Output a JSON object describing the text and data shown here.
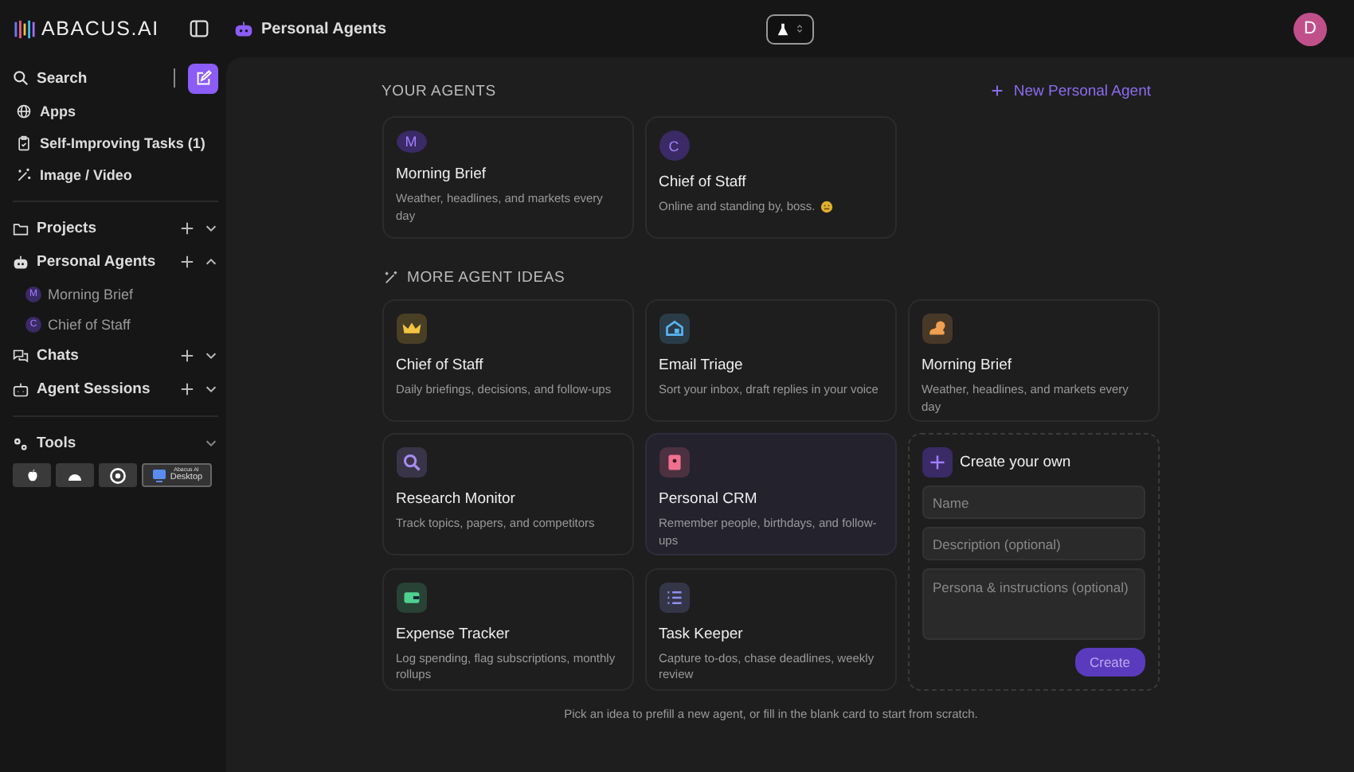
{
  "brand": "ABACUS.AI",
  "header": {
    "title": "Personal Agents",
    "avatar": "D"
  },
  "sidebar": {
    "search": "Search",
    "nav": [
      {
        "label": "Apps"
      },
      {
        "label": "Self-Improving Tasks (1)"
      },
      {
        "label": "Image / Video"
      }
    ],
    "sections": [
      {
        "label": "Projects",
        "expanded": false
      },
      {
        "label": "Personal Agents",
        "expanded": true,
        "children": [
          {
            "label": "Morning Brief",
            "initial": "M"
          },
          {
            "label": "Chief of Staff",
            "initial": "C"
          }
        ]
      },
      {
        "label": "Chats",
        "expanded": false
      },
      {
        "label": "Agent Sessions",
        "expanded": false
      }
    ],
    "tools": {
      "label": "Tools",
      "desktop": [
        "Abacus AI",
        "Desktop"
      ]
    }
  },
  "your_agents": {
    "title": "YOUR AGENTS",
    "new_button": "New Personal Agent",
    "agents": [
      {
        "initial": "M",
        "name": "Morning Brief",
        "description": "Weather, headlines, and markets every day",
        "emoji": false
      },
      {
        "initial": "C",
        "name": "Chief of Staff",
        "description": "Online and standing by, boss.",
        "emoji": true
      }
    ]
  },
  "ideas": {
    "title": "MORE AGENT IDEAS",
    "items": [
      {
        "name": "Chief of Staff",
        "description": "Daily briefings, decisions, and follow-ups",
        "color": "#f5c542",
        "selected": false
      },
      {
        "name": "Email Triage",
        "description": "Sort your inbox, draft replies in your voice",
        "color": "#5ab4f0",
        "selected": false
      },
      {
        "name": "Morning Brief",
        "description": "Weather, headlines, and markets every day",
        "color": "#f0a050",
        "selected": false
      },
      {
        "name": "Research Monitor",
        "description": "Track topics, papers, and competitors",
        "color": "#a68cf0",
        "selected": false
      },
      {
        "name": "Personal CRM",
        "description": "Remember people, birthdays, and follow-ups",
        "color": "#f07090",
        "selected": true
      },
      {
        "name": "Expense Tracker",
        "description": "Log spending, flag subscriptions, monthly rollups",
        "color": "#4fd08f",
        "selected": false
      },
      {
        "name": "Task Keeper",
        "description": "Capture to-dos, chase deadlines, weekly review",
        "color": "#8f90f0",
        "selected": false
      }
    ],
    "create": {
      "title": "Create your own",
      "name_placeholder": "Name",
      "description_placeholder": "Description (optional)",
      "persona_placeholder": "Persona & instructions (optional)",
      "button": "Create"
    }
  },
  "footer": "Pick an idea to prefill a new agent, or fill in the blank card to start from scratch."
}
